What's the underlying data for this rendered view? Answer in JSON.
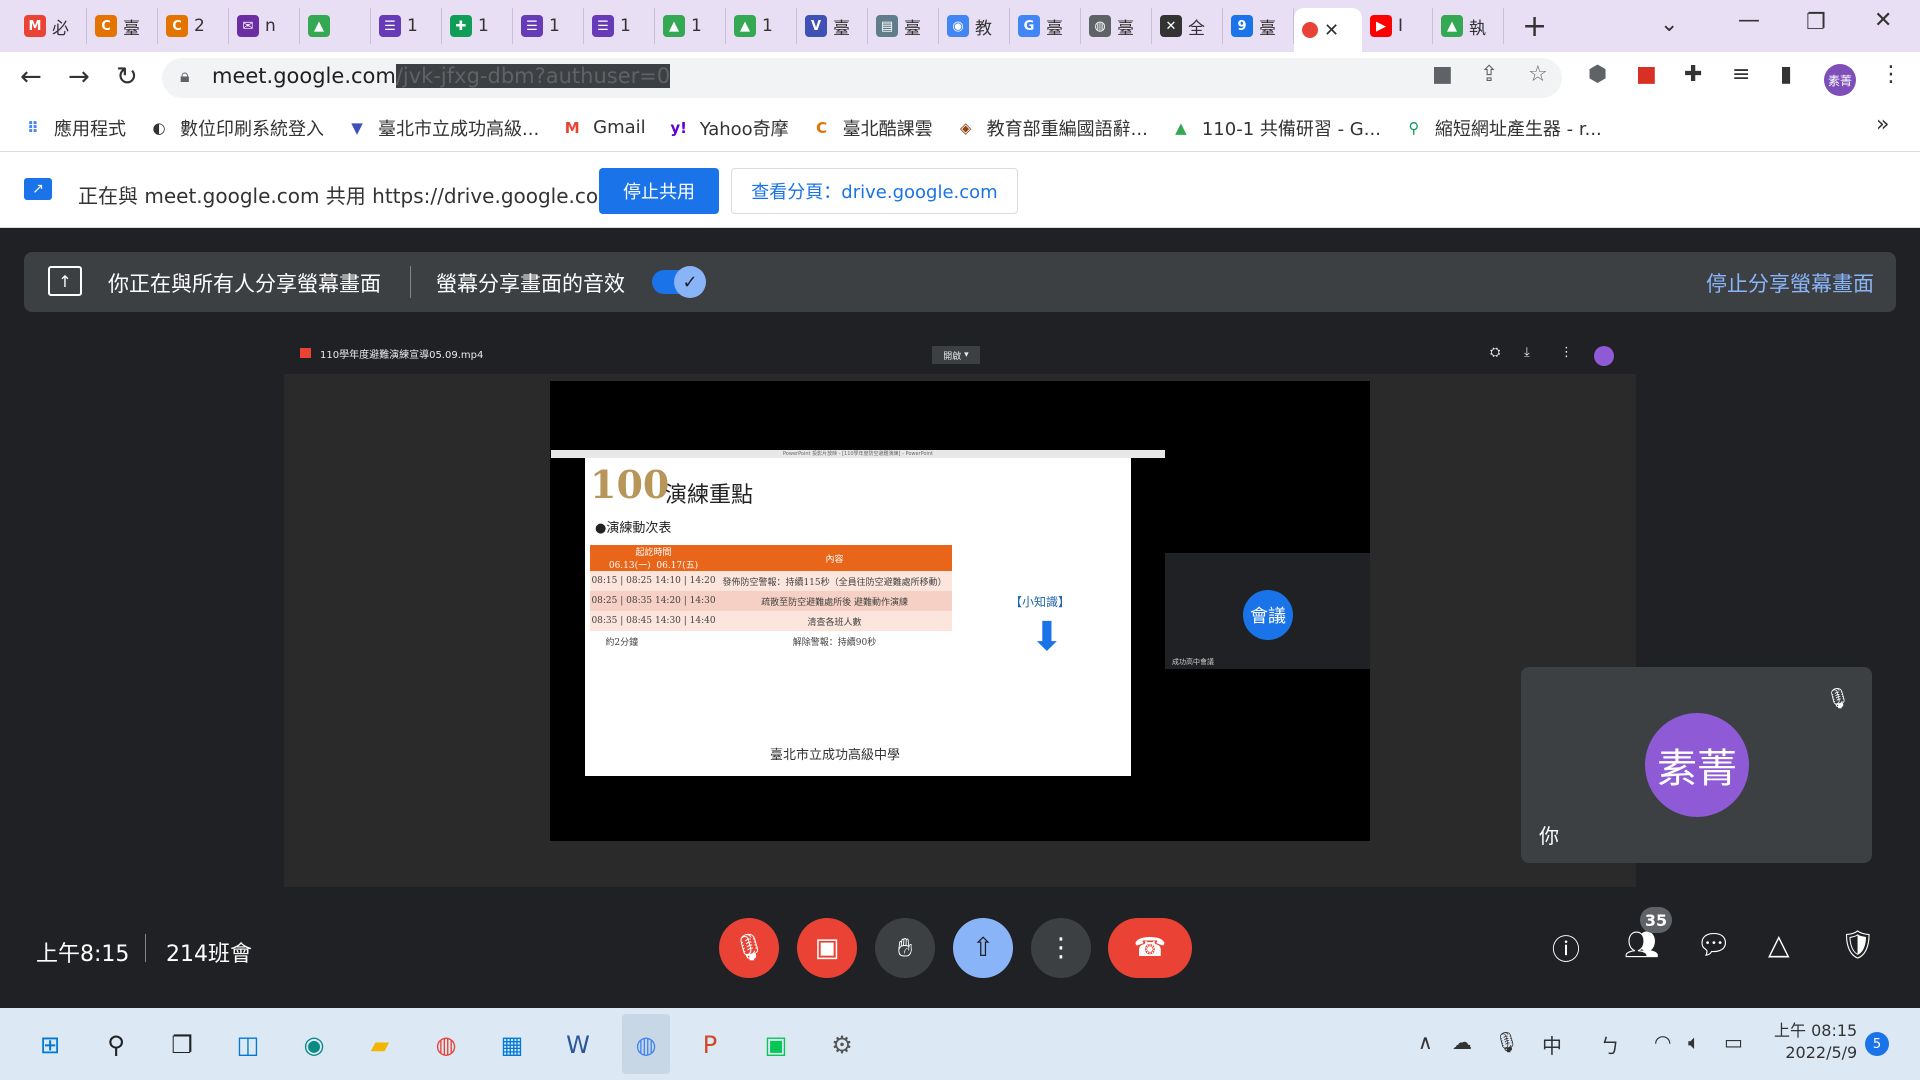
{
  "browser": {
    "tabs": [
      {
        "text": "必",
        "color": "#ea4335",
        "fav": "M"
      },
      {
        "text": "臺",
        "color": "#e37400",
        "fav": "C"
      },
      {
        "text": "2",
        "color": "#e37400",
        "fav": "C"
      },
      {
        "text": "n",
        "color": "#6b2fa3",
        "fav": "✉"
      },
      {
        "text": "",
        "color": "#34a853",
        "fav": "▲"
      },
      {
        "text": "1",
        "color": "#673ab7",
        "fav": "☰"
      },
      {
        "text": "1",
        "color": "#0f9d58",
        "fav": "✚"
      },
      {
        "text": "1",
        "color": "#673ab7",
        "fav": "☰"
      },
      {
        "text": "1",
        "color": "#673ab7",
        "fav": "☰"
      },
      {
        "text": "1",
        "color": "#34a853",
        "fav": "▲"
      },
      {
        "text": "1",
        "color": "#34a853",
        "fav": "▲"
      },
      {
        "text": "臺",
        "color": "#3f51b5",
        "fav": "V"
      },
      {
        "text": "臺",
        "color": "#607d8b",
        "fav": "▤"
      },
      {
        "text": "教",
        "color": "#4285f4",
        "fav": "◉"
      },
      {
        "text": "臺",
        "color": "#4285f4",
        "fav": "G"
      },
      {
        "text": "臺",
        "color": "#5f6368",
        "fav": "◍"
      },
      {
        "text": "全",
        "color": "#333333",
        "fav": "✕"
      },
      {
        "text": "臺",
        "color": "#1a73e8",
        "fav": "9"
      }
    ],
    "active_tab_close": "✕",
    "extra_tabs": [
      {
        "text": "I",
        "color": "#ff0000",
        "fav": "▶"
      },
      {
        "text": "執",
        "color": "#34a853",
        "fav": "▲"
      }
    ],
    "url_host": "meet.google.com",
    "url_path": "/jvk-jfxg-dbm?authuser=0",
    "profile_label": "素菁"
  },
  "bookmarks": [
    {
      "label": "應用程式",
      "icon": "⠿",
      "color": "#4285f4"
    },
    {
      "label": "數位印刷系統登入",
      "icon": "◐",
      "color": "#333333"
    },
    {
      "label": "臺北市立成功高級...",
      "icon": "▼",
      "color": "#3f51b5"
    },
    {
      "label": "Gmail",
      "icon": "M",
      "color": "#ea4335"
    },
    {
      "label": "Yahoo奇摩",
      "icon": "y!",
      "color": "#6001d2"
    },
    {
      "label": "臺北酷課雲",
      "icon": "C",
      "color": "#e37400"
    },
    {
      "label": "教育部重編國語辭...",
      "icon": "◈",
      "color": "#8b4513"
    },
    {
      "label": "110-1 共備研習 - G...",
      "icon": "▲",
      "color": "#34a853"
    },
    {
      "label": "縮短網址產生器 - r...",
      "icon": "⚲",
      "color": "#0f9d58"
    }
  ],
  "bookmarks_more": "»",
  "share_bar": {
    "text": "正在與 meet.google.com 共用 https://drive.google.com",
    "stop_label": "停止共用",
    "view_label": "查看分頁：drive.google.com"
  },
  "meet_banner": {
    "sharing_text": "你正在與所有人分享螢幕畫面",
    "audio_text": "螢幕分享畫面的音效",
    "stop_text": "停止分享螢幕畫面"
  },
  "shared_screen": {
    "video_title": "110學年度避難演練宣導05.09.mp4",
    "open_with": "開啟",
    "slide": {
      "window_title": "PowerPoint 投影片放映 - [110學年度防空避難演練] - PowerPoint",
      "logo": "100",
      "title": "演練重點",
      "subtitle": "●演練動次表",
      "table_headers": [
        "起訖時間",
        "內容"
      ],
      "table_subheaders": [
        "06.13(一)",
        "06.17(五)"
      ],
      "rows": [
        [
          "08:15 | 08:25",
          "14:10 | 14:20",
          "發佈防空警報：持續115秒（全員往防空避難處所移動）"
        ],
        [
          "08:25 | 08:35",
          "14:20 | 14:30",
          "疏散至防空避難處所後 避難動作演練"
        ],
        [
          "08:35 | 08:45",
          "14:30 | 14:40",
          "清查各班人數"
        ],
        [
          "約2分鐘",
          "",
          "解除警報：持續90秒"
        ]
      ],
      "tip": "【小知識】",
      "footer": "臺北市立成功高級中學"
    },
    "meeting_tile_avatar": "會議",
    "meeting_tile_label": "成功高中會議"
  },
  "self_tile": {
    "avatar": "素菁",
    "label": "你"
  },
  "bottom_bar": {
    "time": "上午8:15",
    "meeting_name": "214班會",
    "participants_count": "35"
  },
  "taskbar": {
    "clock_time": "上午 08:15",
    "clock_date": "2022/5/9",
    "notifications": "5",
    "ime": "中",
    "ime2": "ㄅ"
  }
}
